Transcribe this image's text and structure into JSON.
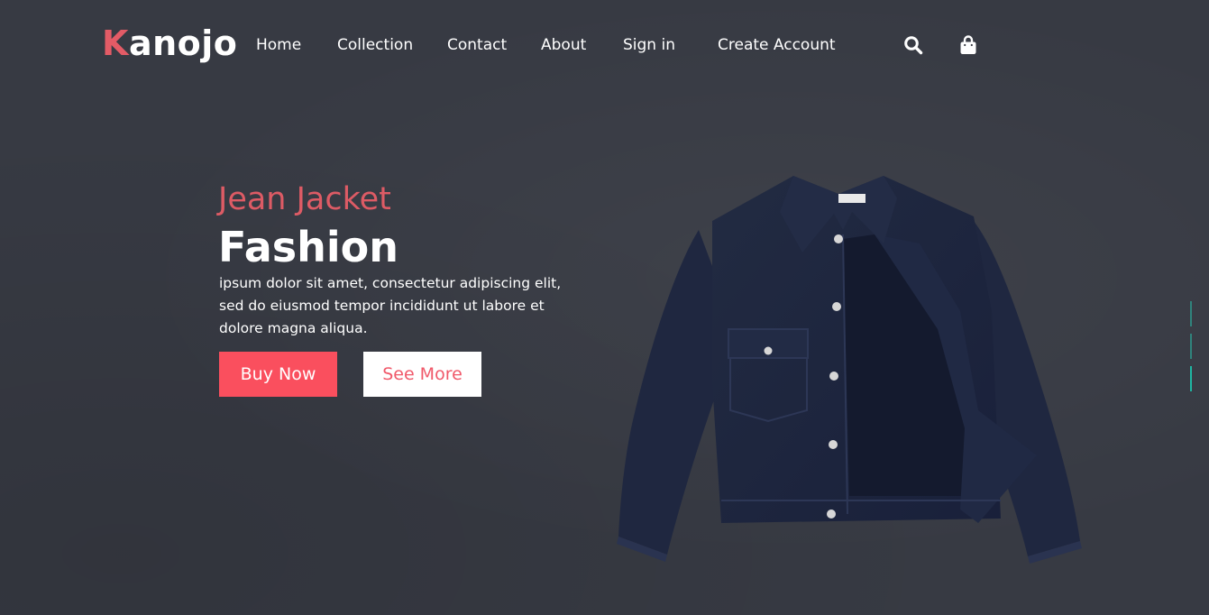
{
  "brand": {
    "first_letter": "K",
    "rest": "anojo",
    "accent_color": "#e35b66"
  },
  "nav": {
    "items": [
      {
        "label": "Home"
      },
      {
        "label": "Collection"
      },
      {
        "label": "Contact"
      },
      {
        "label": "About"
      },
      {
        "label": "Sign in"
      },
      {
        "label": "Create Account"
      }
    ],
    "icons": [
      "search-icon",
      "shopping-bag-icon"
    ]
  },
  "hero": {
    "subtitle": "Jean Jacket",
    "title": "Fashion",
    "description": "ipsum dolor sit amet, consectetur adipiscing elit, sed do eiusmod tempor incididunt ut labore et dolore magna aliqua.",
    "buy_label": "Buy Now",
    "more_label": "See More",
    "buy_color": "#fa4f5e",
    "image": "denim-jacket-image"
  },
  "slider": {
    "count": 3,
    "active_index": 2,
    "active_color": "#1fb5a2",
    "inactive_color": "#2f8f86"
  },
  "colors": {
    "background": "#373a43",
    "jacket": "#1c2438"
  }
}
